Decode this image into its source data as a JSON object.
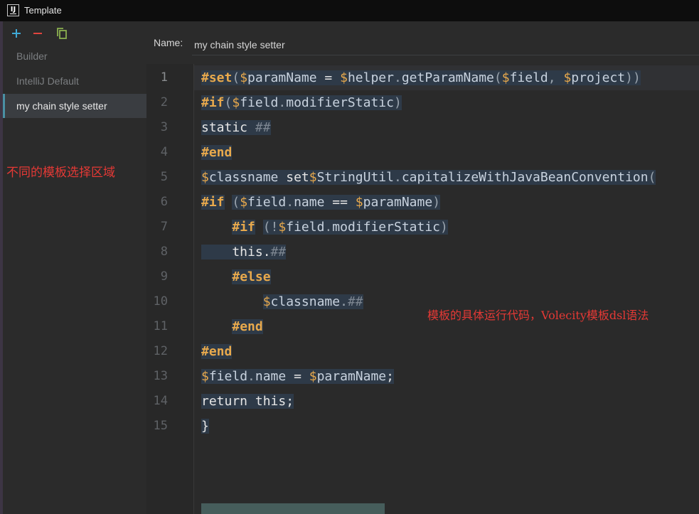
{
  "window": {
    "title": "Template",
    "app_icon_text": "IJ"
  },
  "toolbar": {
    "add_icon": "plus-icon",
    "remove_icon": "minus-icon",
    "copy_icon": "copy-icon"
  },
  "templates": [
    {
      "label": "Builder",
      "selected": false
    },
    {
      "label": "IntelliJ Default",
      "selected": false
    },
    {
      "label": "my chain style setter",
      "selected": true
    }
  ],
  "name_field": {
    "label": "Name:",
    "value": "my chain style setter"
  },
  "annotations": {
    "left": "不同的模板选择区域",
    "right": "模板的具体运行代码，Volecity模板dsl语法"
  },
  "editor": {
    "line_numbers": [
      "1",
      "2",
      "3",
      "4",
      "5",
      "6",
      "7",
      "8",
      "9",
      "10",
      "11",
      "12",
      "13",
      "14",
      "15"
    ],
    "current_line": 1,
    "lines": [
      [
        [
          "kw",
          "#set"
        ],
        [
          "pu",
          "("
        ],
        [
          "v",
          "$"
        ],
        [
          "id",
          "paramName"
        ],
        [
          "pl",
          " = "
        ],
        [
          "v",
          "$"
        ],
        [
          "id",
          "helper"
        ],
        [
          "pu",
          "."
        ],
        [
          "id",
          "getParamName"
        ],
        [
          "pu",
          "("
        ],
        [
          "v",
          "$"
        ],
        [
          "id",
          "field"
        ],
        [
          "pu",
          ", "
        ],
        [
          "v",
          "$"
        ],
        [
          "id",
          "project"
        ],
        [
          "pu",
          "))"
        ]
      ],
      [
        [
          "kw",
          "#if"
        ],
        [
          "pu",
          "("
        ],
        [
          "v",
          "$"
        ],
        [
          "id",
          "field"
        ],
        [
          "pu",
          "."
        ],
        [
          "id",
          "modifierStatic"
        ],
        [
          "pu",
          ")"
        ]
      ],
      [
        [
          "pl",
          "static "
        ],
        [
          "cm",
          "##"
        ]
      ],
      [
        [
          "kw",
          "#end"
        ]
      ],
      [
        [
          "v",
          "$"
        ],
        [
          "id",
          "classname"
        ],
        [
          "pl",
          " set"
        ],
        [
          "v",
          "$"
        ],
        [
          "id",
          "StringUtil"
        ],
        [
          "pu",
          "."
        ],
        [
          "id",
          "capitalizeWithJavaBeanConvention"
        ],
        [
          "pu",
          "("
        ]
      ],
      [
        [
          "kw",
          "#if"
        ],
        [
          "pl",
          " "
        ],
        [
          "pu",
          "("
        ],
        [
          "v",
          "$"
        ],
        [
          "id",
          "field"
        ],
        [
          "pu",
          "."
        ],
        [
          "id",
          "name"
        ],
        [
          "pl",
          " == "
        ],
        [
          "v",
          "$"
        ],
        [
          "id",
          "paramName"
        ],
        [
          "pu",
          ")"
        ]
      ],
      [
        [
          "pl",
          "    "
        ],
        [
          "kw",
          "#if"
        ],
        [
          "pl",
          " "
        ],
        [
          "pu",
          "(!"
        ],
        [
          "v",
          "$"
        ],
        [
          "id",
          "field"
        ],
        [
          "pu",
          "."
        ],
        [
          "id",
          "modifierStatic"
        ],
        [
          "pu",
          ")"
        ]
      ],
      [
        [
          "pl",
          "    this."
        ],
        [
          "cm",
          "##"
        ]
      ],
      [
        [
          "pl",
          "    "
        ],
        [
          "kw",
          "#else"
        ]
      ],
      [
        [
          "pl",
          "        "
        ],
        [
          "v",
          "$"
        ],
        [
          "id",
          "classname"
        ],
        [
          "pu",
          "."
        ],
        [
          "cm",
          "##"
        ]
      ],
      [
        [
          "pl",
          "    "
        ],
        [
          "kw",
          "#end"
        ]
      ],
      [
        [
          "kw",
          "#end"
        ]
      ],
      [
        [
          "v",
          "$"
        ],
        [
          "id",
          "field"
        ],
        [
          "pu",
          "."
        ],
        [
          "id",
          "name"
        ],
        [
          "pl",
          " = "
        ],
        [
          "v",
          "$"
        ],
        [
          "id",
          "paramName"
        ],
        [
          "pl",
          ";"
        ]
      ],
      [
        [
          "pl",
          "return this;"
        ]
      ],
      [
        [
          "pl",
          "}"
        ]
      ]
    ]
  },
  "colors": {
    "accent": "#4a90a4",
    "keyword": "#e8a94c",
    "annotation": "#e53935",
    "add": "#3fa9d6",
    "remove": "#e0443e",
    "copy": "#8bb04f"
  }
}
